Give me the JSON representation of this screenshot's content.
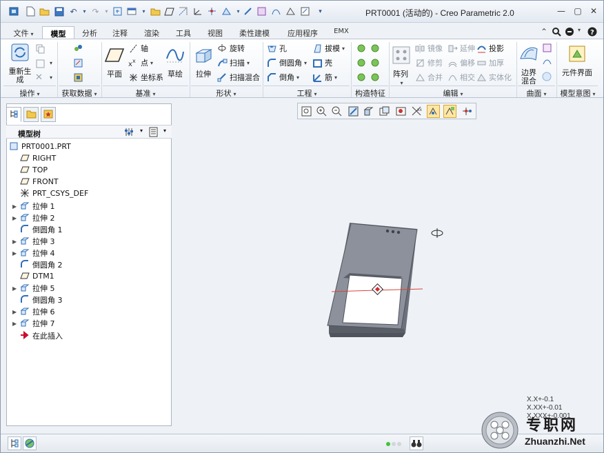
{
  "window": {
    "title": "PRT0001 (活动的) - Creo Parametric 2.0"
  },
  "tabs": {
    "items": [
      {
        "label": "文件",
        "has_dropdown": true
      },
      {
        "label": "模型",
        "active": true
      },
      {
        "label": "分析"
      },
      {
        "label": "注释"
      },
      {
        "label": "渲染"
      },
      {
        "label": "工具"
      },
      {
        "label": "视图"
      },
      {
        "label": "柔性建模"
      },
      {
        "label": "应用程序"
      },
      {
        "label": "EMX"
      }
    ]
  },
  "ribbon": {
    "operations": {
      "regenerate": "重新生成",
      "group": "操作"
    },
    "get_data": {
      "group": "获取数据"
    },
    "datum": {
      "plane": "平面",
      "axis": "轴",
      "point": "点",
      "csys": "坐标系",
      "sketch": "草绘",
      "group": "基准"
    },
    "shapes": {
      "extrude": "拉伸",
      "revolve": "旋转",
      "sweep": "扫描",
      "swept_blend": "扫描混合",
      "group": "形状"
    },
    "engineering": {
      "hole": "孔",
      "round": "倒圆角",
      "chamfer": "倒角",
      "draft": "拔模",
      "shell": "壳",
      "rib": "筋",
      "group": "工程"
    },
    "construction": {
      "group": "构造特征"
    },
    "editing": {
      "pattern": "阵列",
      "mirror": "镜像",
      "trim": "修剪",
      "merge": "合并",
      "extend": "延伸",
      "offset": "偏移",
      "intersect": "相交",
      "project": "投影",
      "thicken": "加厚",
      "solidify": "实体化",
      "group": "编辑"
    },
    "surfaces": {
      "boundary_blend": "边界混合",
      "group": "曲面"
    },
    "model_intent": {
      "component_interface": "元件界面",
      "group": "模型意图"
    }
  },
  "model_tree": {
    "title": "模型树",
    "items": [
      {
        "label": "PRT0001.PRT",
        "icon": "part-icon"
      },
      {
        "label": "RIGHT",
        "icon": "datum-plane-icon"
      },
      {
        "label": "TOP",
        "icon": "datum-plane-icon"
      },
      {
        "label": "FRONT",
        "icon": "datum-plane-icon"
      },
      {
        "label": "PRT_CSYS_DEF",
        "icon": "csys-icon"
      },
      {
        "label": "拉伸 1",
        "icon": "extrude-icon",
        "expandable": true
      },
      {
        "label": "拉伸 2",
        "icon": "extrude-icon",
        "expandable": true
      },
      {
        "label": "倒圆角 1",
        "icon": "round-icon"
      },
      {
        "label": "拉伸 3",
        "icon": "extrude-icon",
        "expandable": true
      },
      {
        "label": "拉伸 4",
        "icon": "extrude-icon",
        "expandable": true
      },
      {
        "label": "倒圆角 2",
        "icon": "round-icon"
      },
      {
        "label": "DTM1",
        "icon": "datum-plane-icon"
      },
      {
        "label": "拉伸 5",
        "icon": "extrude-icon",
        "expandable": true
      },
      {
        "label": "倒圆角 3",
        "icon": "round-icon"
      },
      {
        "label": "拉伸 6",
        "icon": "extrude-icon",
        "expandable": true
      },
      {
        "label": "拉伸 7",
        "icon": "extrude-icon",
        "expandable": true
      },
      {
        "label": "在此插入",
        "icon": "insert-here-icon"
      }
    ]
  },
  "tolerance": [
    "X.X+-0.1",
    "X.XX+-0.01",
    "X.XXX+-0.001"
  ],
  "watermark": {
    "cn": "专职网",
    "en": "Zhuanzhi.Net"
  },
  "colors": {
    "accent": "#2f6fb8",
    "model": "#8d919b",
    "active_tab": "#ffffff",
    "highlight": "#ffe6a6"
  }
}
